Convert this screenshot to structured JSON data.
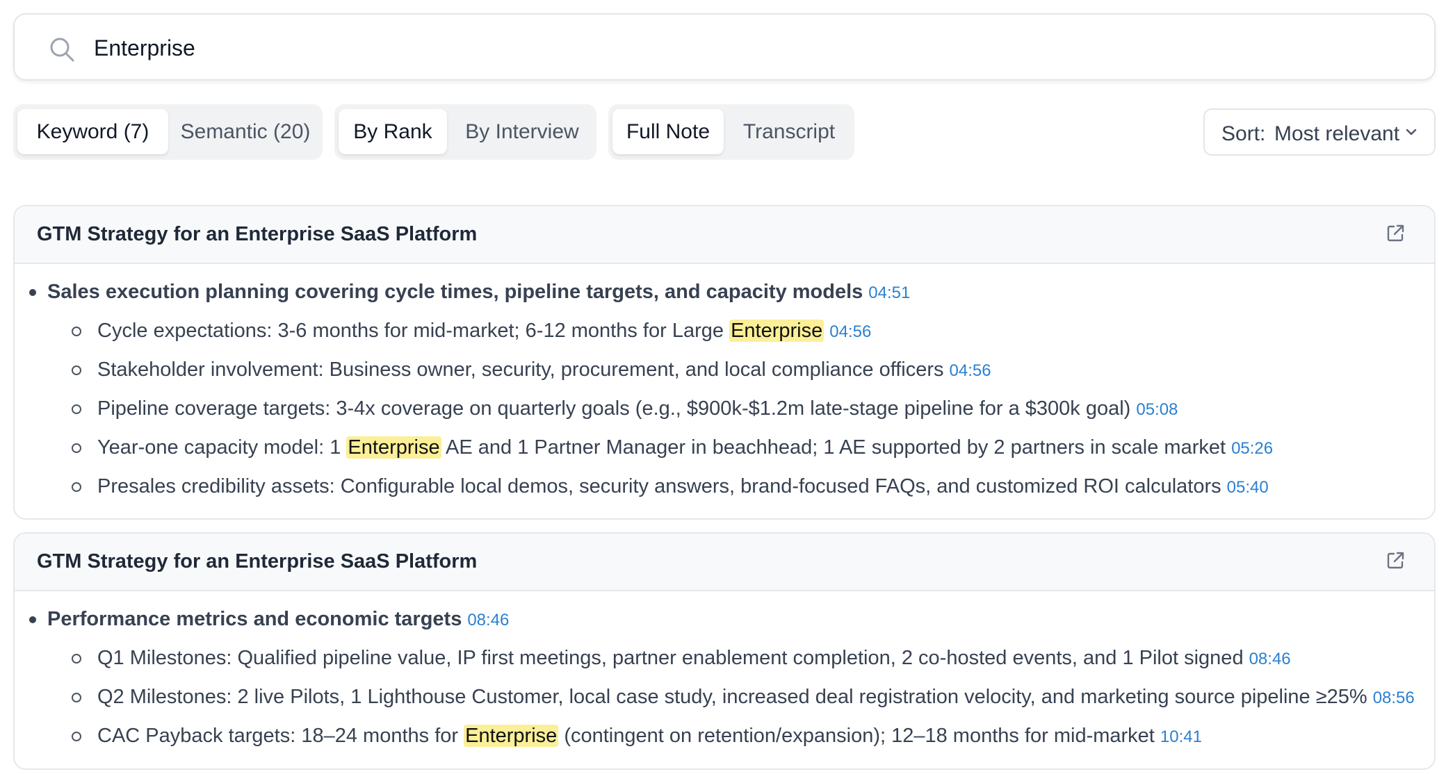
{
  "search": {
    "value": "Enterprise"
  },
  "segments": {
    "match": [
      "Keyword (7)",
      "Semantic (20)"
    ],
    "group": [
      "By Rank",
      "By Interview"
    ],
    "view": [
      "Full Note",
      "Transcript"
    ]
  },
  "sort": {
    "label": "Sort:",
    "value": "Most relevant"
  },
  "results": [
    {
      "title": "GTM Strategy for an Enterprise SaaS Platform",
      "topic": {
        "text": "Sales execution planning covering cycle times, pipeline targets, and capacity models",
        "ts": "04:51"
      },
      "items": [
        {
          "before": "Cycle expectations: 3-6 months for mid-market; 6-12 months for Large ",
          "hl": "Enterprise",
          "after": "",
          "ts": "04:56"
        },
        {
          "before": "Stakeholder involvement: Business owner, security, procurement, and local compliance officers",
          "hl": "",
          "after": "",
          "ts": "04:56"
        },
        {
          "before": "Pipeline coverage targets: 3-4x coverage on quarterly goals (e.g., $900k-$1.2m late-stage pipeline for a $300k goal)",
          "hl": "",
          "after": "",
          "ts": "05:08"
        },
        {
          "before": "Year-one capacity model: 1 ",
          "hl": "Enterprise",
          "after": " AE and 1 Partner Manager in beachhead; 1 AE supported by 2 partners in scale market",
          "ts": "05:26"
        },
        {
          "before": "Presales credibility assets: Configurable local demos, security answers, brand-focused FAQs, and customized ROI calculators",
          "hl": "",
          "after": "",
          "ts": "05:40"
        }
      ]
    },
    {
      "title": "GTM Strategy for an Enterprise SaaS Platform",
      "topic": {
        "text": "Performance metrics and economic targets",
        "ts": "08:46"
      },
      "items": [
        {
          "before": "Q1 Milestones: Qualified pipeline value, IP first meetings, partner enablement completion, 2 co-hosted events, and 1 Pilot signed",
          "hl": "",
          "after": "",
          "ts": "08:46"
        },
        {
          "before": "Q2 Milestones: 2 live Pilots, 1 Lighthouse Customer, local case study, increased deal registration velocity, and marketing source pipeline ≥25%",
          "hl": "",
          "after": "",
          "ts": "08:56"
        },
        {
          "before": "CAC Payback targets: 18–24 months for ",
          "hl": "Enterprise",
          "after": " (contingent on retention/expansion); 12–18 months for mid-market",
          "ts": "10:41"
        }
      ]
    }
  ],
  "colors": {
    "timestamp": "#2b7fd1",
    "highlight": "#fbef97",
    "border": "#e5e7eb"
  },
  "icons": {
    "search": "search-icon",
    "external": "external-link-icon",
    "sort": "chevron-down-icon"
  }
}
